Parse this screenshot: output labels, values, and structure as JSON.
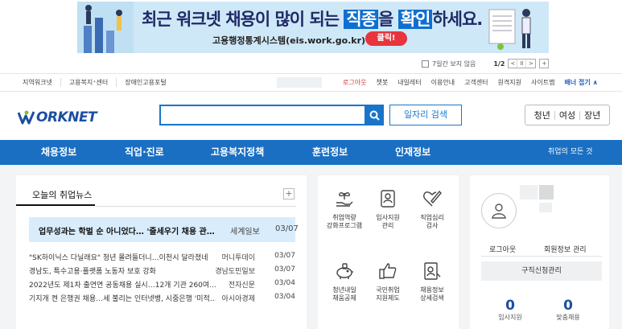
{
  "banner": {
    "headline_pre": "최근 워크넷 채용이 많이 되는 ",
    "headline_hl1": "직종",
    "headline_mid": "을 ",
    "headline_hl2": "확인",
    "headline_post": "하세요.",
    "subtext": "고용행정통계시스템(eis.work.go.kr)",
    "cta": "클릭!",
    "hide_week": "7일간 보지 않음",
    "page": "1/2",
    "prev": "<",
    "pause": "II",
    "next": ">",
    "add": "+"
  },
  "util": {
    "left": [
      "지역워크넷",
      "고용복지⁺센터",
      "장애인고용포털"
    ],
    "right": [
      "로그아웃",
      "챗봇",
      "내일레터",
      "이용안내",
      "고객센터",
      "원격지원",
      "사이트맵"
    ],
    "banner_fold": "배너 접기 ∧"
  },
  "header": {
    "logo": "ORKNET",
    "job_search": "일자리 검색",
    "persona": [
      "청년",
      "여성",
      "장년"
    ]
  },
  "gnb": {
    "items": [
      "채용정보",
      "직업·진로",
      "고용복지정책",
      "훈련정보",
      "인재정보"
    ],
    "all": "취업의 모든 것"
  },
  "news": {
    "tab": "오늘의 취업뉴스",
    "more": "+",
    "featured": {
      "title": "업무성과는 학벌 순 아니었다… '줄세우기 채용 관…",
      "source": "세계일보",
      "date": "03/07"
    },
    "items": [
      {
        "title": "\"SK하이닉스 다닐래요\" 청년 몰려들더니…이천시 달라졌네",
        "source": "머니투데이",
        "date": "03/07"
      },
      {
        "title": "경남도, 특수고용·플랫폼 노동자 보호 강화",
        "source": "경남도민일보",
        "date": "03/07"
      },
      {
        "title": "2022년도 제1차 출연연 공동채용 실시…12개 기관 260여…",
        "source": "전자신문",
        "date": "03/04"
      },
      {
        "title": "기지개 켠 은행권 채용…세 불리는 인터넷뱅, 시중은행 '미적…",
        "source": "아시아경제",
        "date": "03/04"
      }
    ]
  },
  "services": [
    {
      "icon": "seedling-hand-icon",
      "line1": "취업역량",
      "line2": "강화프로그램"
    },
    {
      "icon": "id-badge-icon",
      "line1": "입사지원",
      "line2": "관리"
    },
    {
      "icon": "heart-pen-icon",
      "line1": "직업심리",
      "line2": "검사"
    },
    {
      "icon": "piggy-bank-icon",
      "line1": "청년내일",
      "line2": "채움공제"
    },
    {
      "icon": "thumbs-up-icon",
      "line1": "국민취업",
      "line2": "지원제도"
    },
    {
      "icon": "document-search-icon",
      "line1": "채용정보",
      "line2": "상세검색"
    }
  ],
  "login": {
    "logout": "로그아웃",
    "member": "회원정보 관리",
    "apply": "구직신청관리",
    "stats": [
      {
        "value": "0",
        "label": "입사지원"
      },
      {
        "value": "0",
        "label": "맞춤채용"
      }
    ]
  },
  "colors": {
    "primary": "#1a6fc2",
    "logo_green": "#7cc242",
    "highlight": "#d9ecfb",
    "cta": "#e8343c"
  }
}
